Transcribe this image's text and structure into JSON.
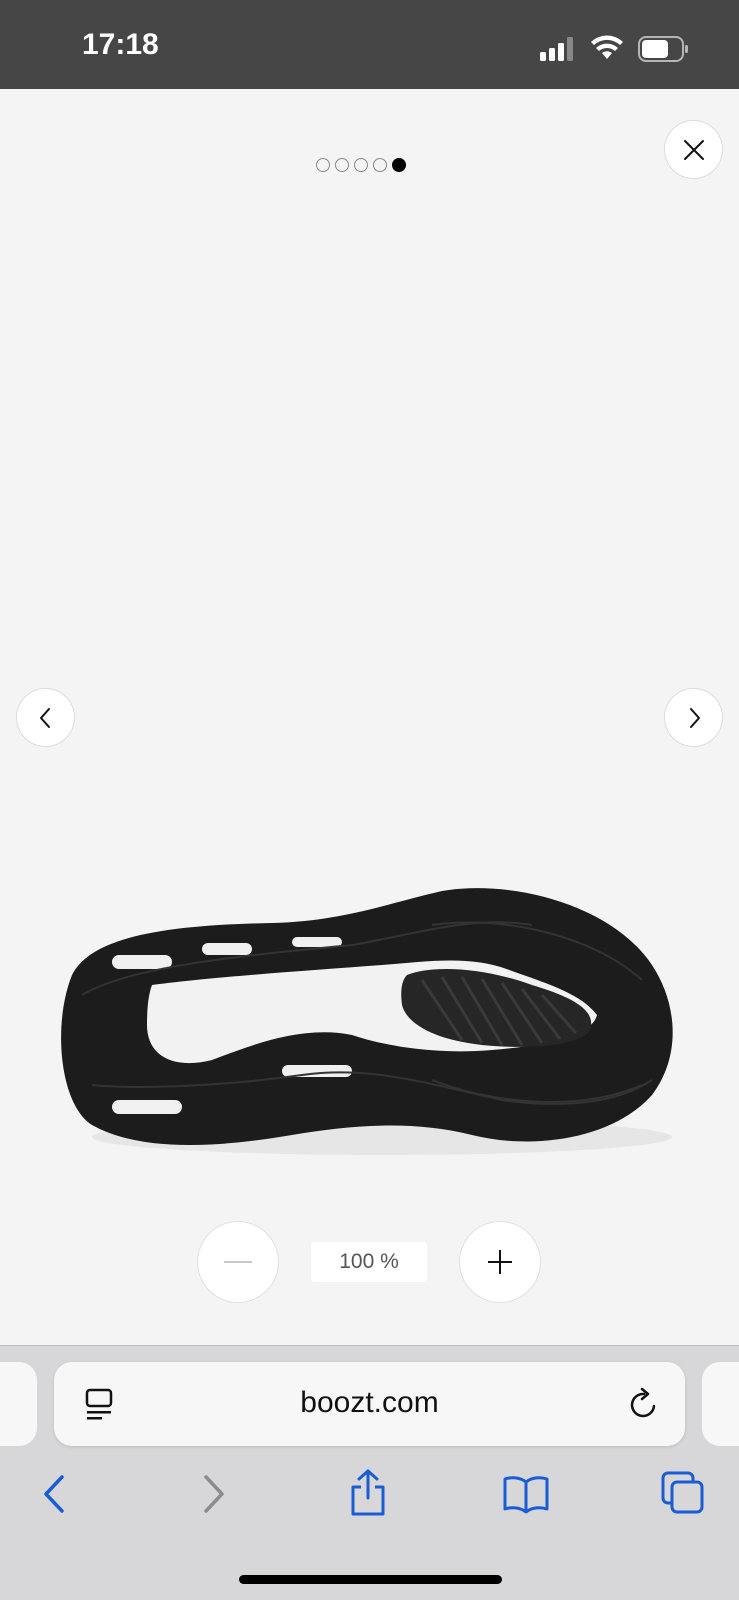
{
  "status_bar": {
    "time": "17:18"
  },
  "gallery": {
    "dot_count": 5,
    "active_dot": 4,
    "product_image": "shoe-outsole-black-boost"
  },
  "zoom": {
    "value": "100 %"
  },
  "browser": {
    "url": "boozt.com"
  },
  "colors": {
    "accent": "#1a5cd6",
    "status_bar": "#464646"
  }
}
